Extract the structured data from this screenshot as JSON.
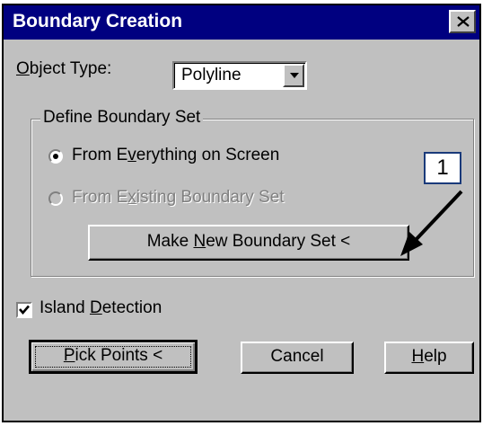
{
  "window": {
    "title": "Boundary Creation"
  },
  "object_type": {
    "label_underlined": "O",
    "label_rest": "bject Type:",
    "value": "Polyline"
  },
  "boundary_set": {
    "legend": "Define Boundary Set",
    "option1": {
      "pre": "From E",
      "u": "v",
      "post": "erything on Screen",
      "selected": true
    },
    "option2": {
      "pre": "From E",
      "u": "x",
      "post": "isting Boundary Set",
      "enabled": false
    },
    "make_new_button": {
      "pre": "Make ",
      "u": "N",
      "post": "ew Boundary Set <"
    }
  },
  "island_detection": {
    "pre": "Island ",
    "u": "D",
    "post": "etection",
    "checked": true
  },
  "buttons": {
    "pick_points": {
      "u": "P",
      "post": "ick Points <"
    },
    "cancel": "Cancel",
    "help": {
      "u": "H",
      "post": "elp"
    }
  },
  "annotation": {
    "callout_number": "1"
  }
}
